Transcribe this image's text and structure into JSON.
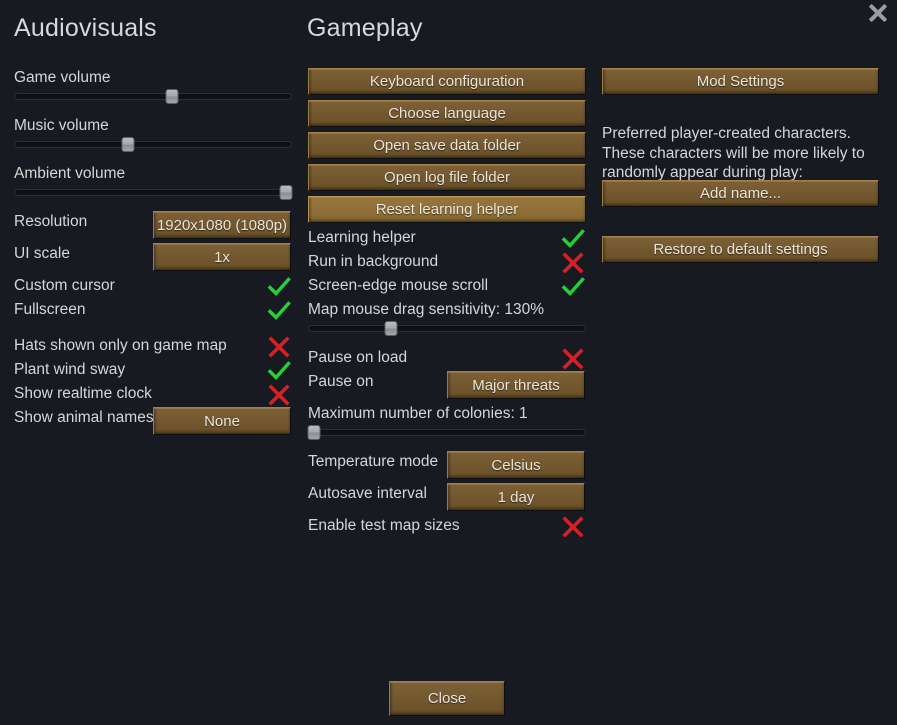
{
  "window": {
    "close_icon": "close-x-icon"
  },
  "audiovisuals": {
    "title": "Audiovisuals",
    "sliders": [
      {
        "label": "Game volume",
        "value_pct": 57,
        "name": "game-volume"
      },
      {
        "label": "Music volume",
        "value_pct": 41,
        "name": "music-volume"
      },
      {
        "label": "Ambient volume",
        "value_pct": 98,
        "name": "ambient-volume"
      }
    ],
    "resolution": {
      "label": "Resolution",
      "value": "1920x1080 (1080p)"
    },
    "ui_scale": {
      "label": "UI scale",
      "value": "1x"
    },
    "toggles_group1": [
      {
        "label": "Custom cursor",
        "state": "on"
      },
      {
        "label": "Fullscreen",
        "state": "on"
      }
    ],
    "toggles_group2": [
      {
        "label": "Hats shown only on game map",
        "state": "off"
      },
      {
        "label": "Plant wind sway",
        "state": "on"
      },
      {
        "label": "Show realtime clock",
        "state": "off"
      }
    ],
    "animal_names": {
      "label": "Show animal names",
      "value": "None"
    }
  },
  "gameplay": {
    "title": "Gameplay",
    "buttons": [
      {
        "label": "Keyboard configuration",
        "hovered": false
      },
      {
        "label": "Choose language",
        "hovered": false
      },
      {
        "label": "Open save data folder",
        "hovered": false
      },
      {
        "label": "Open log file folder",
        "hovered": false
      },
      {
        "label": "Reset learning helper",
        "hovered": true
      }
    ],
    "toggles_top": [
      {
        "label": "Learning helper",
        "state": "on"
      },
      {
        "label": "Run in background",
        "state": "off"
      },
      {
        "label": "Screen-edge mouse scroll",
        "state": "on"
      }
    ],
    "drag_sensitivity": {
      "label": "Map mouse drag sensitivity: 130%",
      "value_pct": 30
    },
    "pause_on_load": {
      "label": "Pause on load",
      "state": "off"
    },
    "pause_on": {
      "label": "Pause on",
      "value": "Major threats"
    },
    "max_colonies": {
      "label": "Maximum number of colonies: 1",
      "value_pct": 2
    },
    "temperature_mode": {
      "label": "Temperature mode",
      "value": "Celsius"
    },
    "autosave_interval": {
      "label": "Autosave interval",
      "value": "1 day"
    },
    "test_map_sizes": {
      "label": "Enable test map sizes",
      "state": "off"
    }
  },
  "right_column": {
    "mod_settings": {
      "label": "Mod Settings"
    },
    "preferred_characters_text": "Preferred player-created characters. These characters will be more likely to randomly appear during play:",
    "add_name": {
      "label": "Add name..."
    },
    "restore_defaults": {
      "label": "Restore to default settings"
    }
  },
  "footer": {
    "close": {
      "label": "Close"
    }
  }
}
